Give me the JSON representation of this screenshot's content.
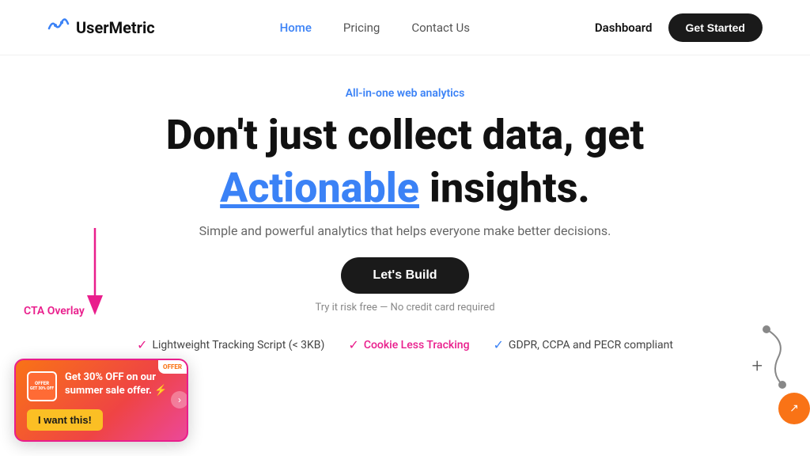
{
  "navbar": {
    "logo_icon": "〜",
    "logo_text": "UserMetric",
    "links": [
      {
        "label": "Home",
        "active": true
      },
      {
        "label": "Pricing",
        "active": false
      },
      {
        "label": "Contact Us",
        "active": false
      }
    ],
    "dashboard_label": "Dashboard",
    "get_started_label": "Get Started"
  },
  "hero": {
    "badge": "All-in-one web analytics",
    "title_line1": "Don't just collect data, get",
    "title_highlight": "Actionable",
    "title_line2_rest": " insights.",
    "subtitle": "Simple and powerful analytics that helps everyone make better decisions.",
    "cta_button": "Let's Build",
    "risk_free": "Try it risk free — No credit card required"
  },
  "features": [
    {
      "icon": "check",
      "color": "plain",
      "text": "Lightweight Tracking Script (< 3KB)"
    },
    {
      "icon": "check",
      "color": "pink",
      "text": "Cookie Less Tracking"
    },
    {
      "icon": "check",
      "color": "blue",
      "text": "GDPR, CCPA and PECR compliant"
    }
  ],
  "cta_overlay": {
    "label": "CTA Overlay",
    "offer_badge_line1": "OFFER",
    "offer_badge_line2": "GET 30% OFF",
    "main_text": "Get 30% OFF on our summer sale offer.",
    "emoji": "⚡",
    "button_label": "I want this!",
    "corner_badge": "OFFER"
  },
  "decorations": {
    "plus": "+",
    "arrow": "↓"
  }
}
